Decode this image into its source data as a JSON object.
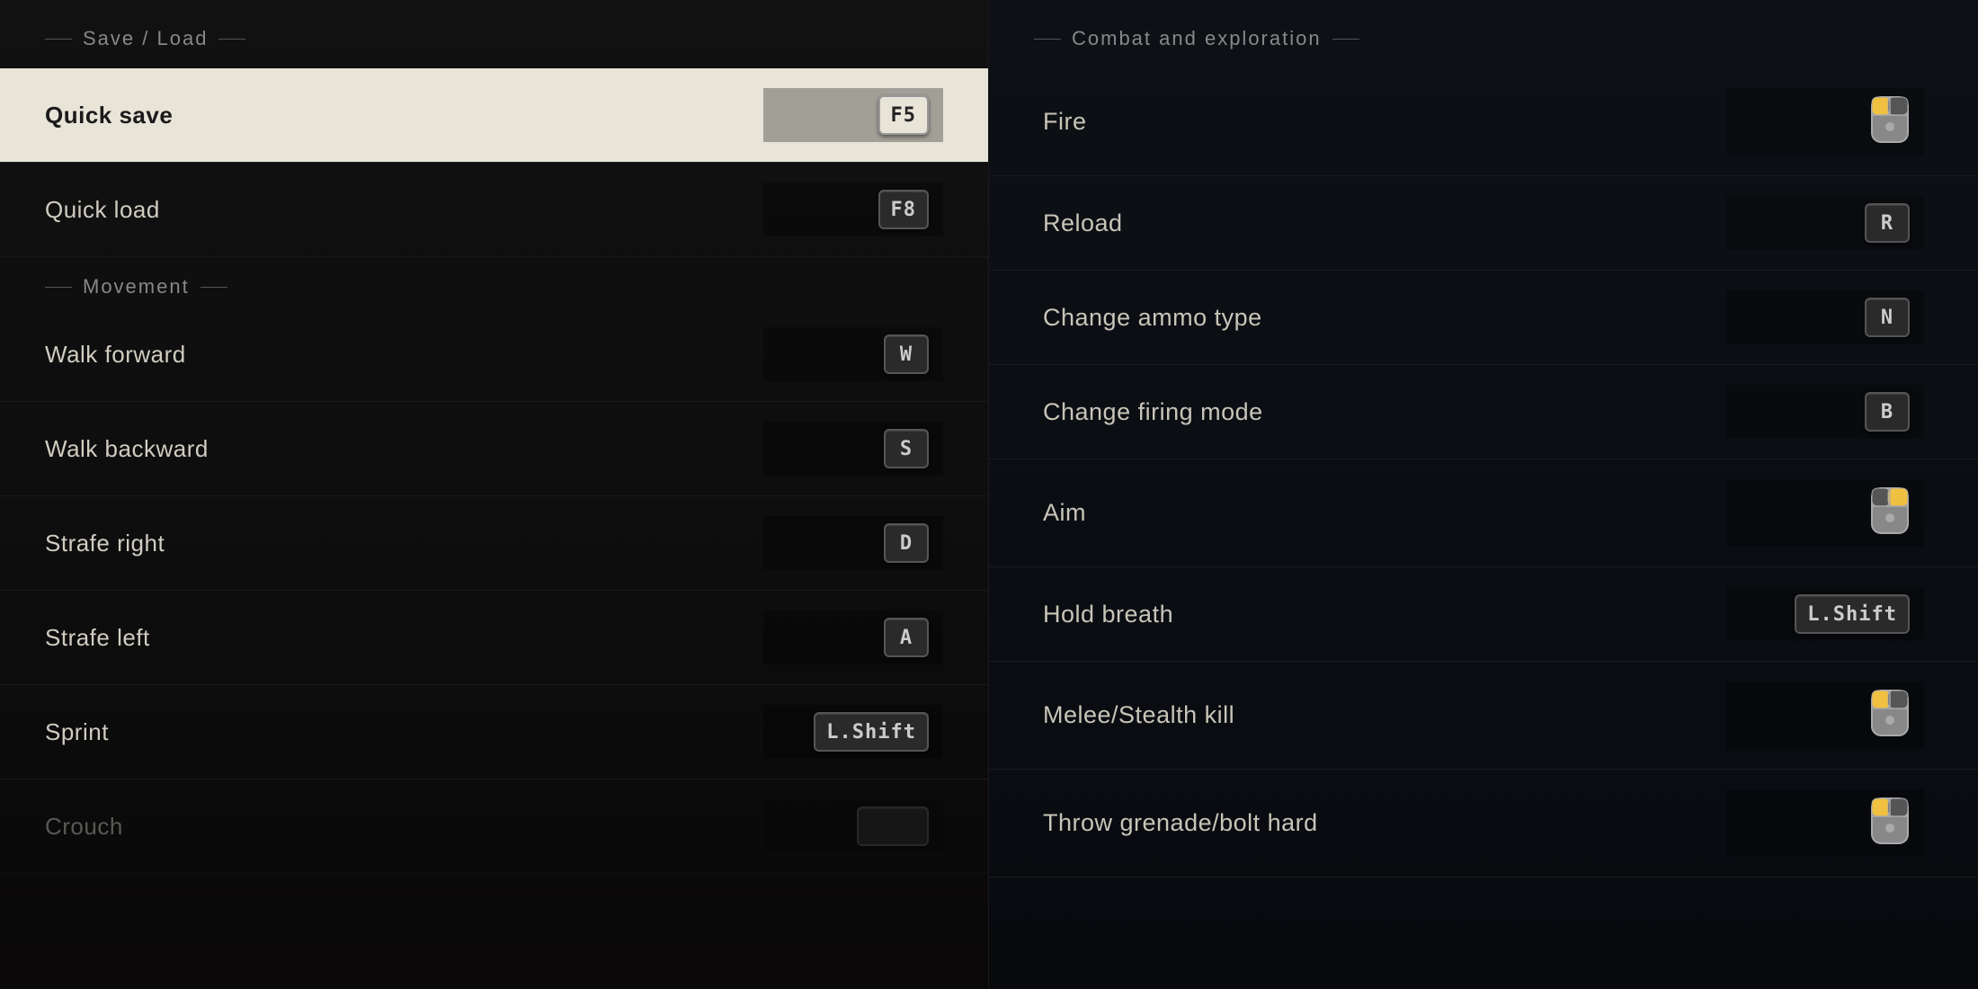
{
  "left_panel": {
    "section_save": "Save / Load",
    "rows_save": [
      {
        "id": "quick-save",
        "label": "Quick save",
        "key": "F5",
        "selected": true,
        "mouse": false
      },
      {
        "id": "quick-load",
        "label": "Quick load",
        "key": "F8",
        "selected": false,
        "mouse": false
      }
    ],
    "section_movement": "Movement",
    "rows_movement": [
      {
        "id": "walk-forward",
        "label": "Walk forward",
        "key": "W",
        "selected": false,
        "mouse": false
      },
      {
        "id": "walk-backward",
        "label": "Walk backward",
        "key": "S",
        "selected": false,
        "mouse": false
      },
      {
        "id": "strafe-right",
        "label": "Strafe right",
        "key": "D",
        "selected": false,
        "mouse": false
      },
      {
        "id": "strafe-left",
        "label": "Strafe left",
        "key": "A",
        "selected": false,
        "mouse": false
      },
      {
        "id": "sprint",
        "label": "Sprint",
        "key": "L.Shift",
        "selected": false,
        "mouse": false
      },
      {
        "id": "crouch",
        "label": "Crouch",
        "key": "",
        "selected": false,
        "mouse": false
      }
    ]
  },
  "right_panel": {
    "section_combat": "Combat and exploration",
    "rows": [
      {
        "id": "fire",
        "label": "Fire",
        "key": "",
        "mouse": true,
        "mouse_button": "left"
      },
      {
        "id": "reload",
        "label": "Reload",
        "key": "R",
        "mouse": false
      },
      {
        "id": "change-ammo",
        "label": "Change ammo type",
        "key": "N",
        "mouse": false
      },
      {
        "id": "change-firing-mode",
        "label": "Change firing mode",
        "key": "B",
        "mouse": false
      },
      {
        "id": "aim",
        "label": "Aim",
        "key": "",
        "mouse": true,
        "mouse_button": "right"
      },
      {
        "id": "hold-breath",
        "label": "Hold breath",
        "key": "L.Shift",
        "mouse": false
      },
      {
        "id": "melee-stealth",
        "label": "Melee/Stealth kill",
        "key": "",
        "mouse": true,
        "mouse_button": "left"
      },
      {
        "id": "throw-grenade",
        "label": "Throw grenade/bolt hard",
        "key": "",
        "mouse": true,
        "mouse_button": "left"
      }
    ]
  }
}
